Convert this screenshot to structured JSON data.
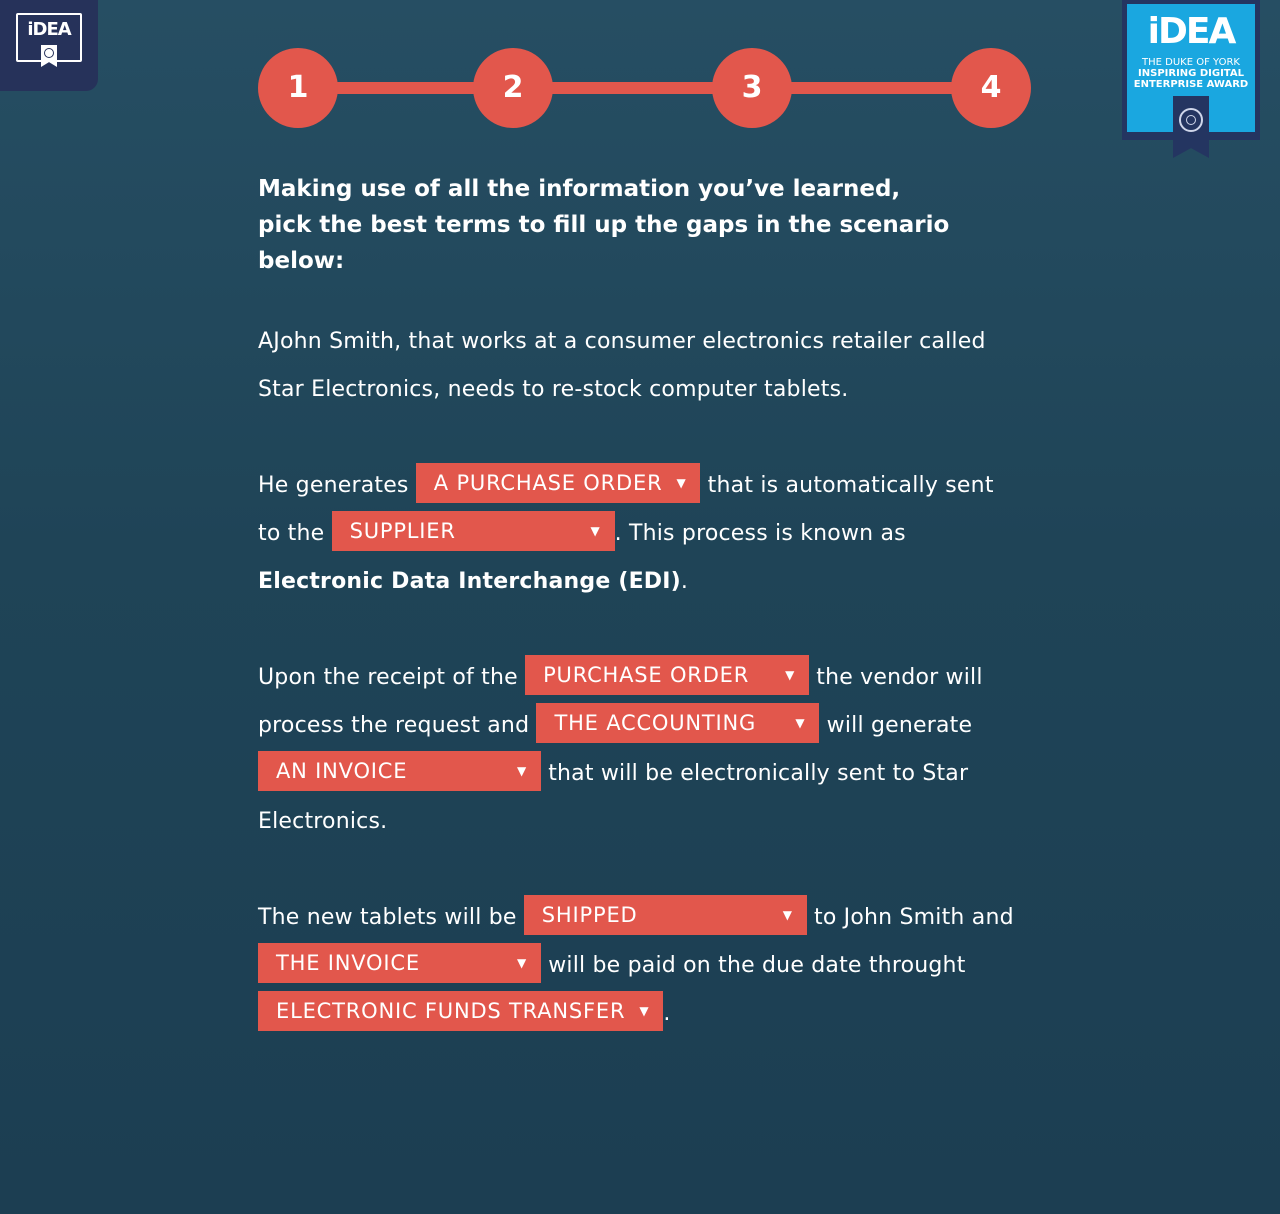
{
  "logo_small": {
    "text": "iDEA"
  },
  "award_badge": {
    "brand": "iDEA",
    "line1": "THE DUKE OF YORK",
    "line2": "INSPIRING DIGITAL",
    "line3": "ENTERPRISE AWARD"
  },
  "stepper": {
    "steps": [
      "1",
      "2",
      "3",
      "4"
    ]
  },
  "instructions": {
    "line1": "Making use of all the information  you’ve learned,",
    "line2": "pick the best terms to fill up the gaps in the scenario",
    "line3": "below:"
  },
  "scenario": {
    "p1": "AJohn Smith, that works at a consumer electronics retailer called Star Electronics, needs to re-stock computer tablets.",
    "p2_a": "He generates ",
    "p2_b": " that is automatically sent to the ",
    "p2_c": ". This process is known as ",
    "p2_bold": "Electronic Data Interchange (EDI)",
    "p2_d": ".",
    "p3_a": "Upon the receipt of the ",
    "p3_b": " the vendor will process the request and ",
    "p3_c": " will generate ",
    "p3_d": " that will be electronically sent to Star Electronics.",
    "p4_a": "The new tablets will be ",
    "p4_b": "  to John Smith and ",
    "p4_c": " will be paid on the due date throught ",
    "p4_d": "."
  },
  "dropdowns": {
    "d1": "A PURCHASE ORDER",
    "d2": "SUPPLIER",
    "d3": "PURCHASE ORDER",
    "d4": "THE ACCOUNTING",
    "d5": "AN INVOICE",
    "d6": "SHIPPED",
    "d7": "THE INVOICE",
    "d8": "ELECTRONIC FUNDS TRANSFER"
  },
  "icons": {
    "dropdown_arrow": "▼"
  },
  "colors": {
    "accent": "#e2574c",
    "background": "#214659",
    "badge_blue": "#1aa7e0",
    "navy": "#243561"
  }
}
